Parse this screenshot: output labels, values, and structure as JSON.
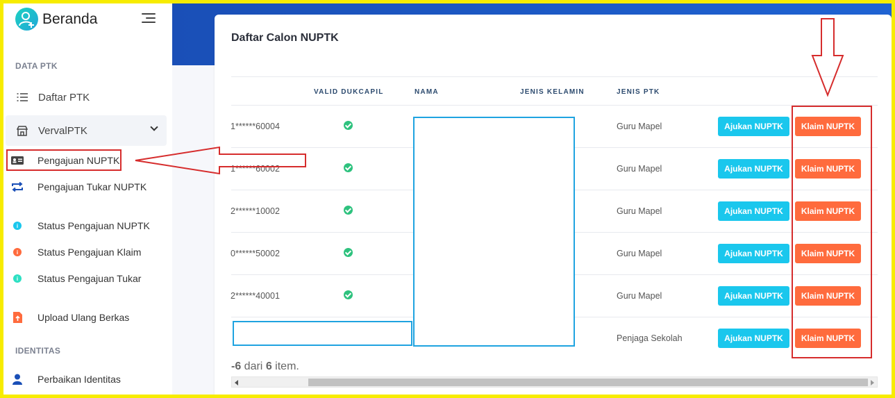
{
  "sidebar": {
    "brand": "Beranda",
    "section_data_ptk": "DATA PTK",
    "section_identitas": "IDENTITAS",
    "items": [
      {
        "label": "Daftar PTK",
        "icon": "list-icon"
      },
      {
        "label": "VervalPTK",
        "icon": "store-icon"
      },
      {
        "label": "Pengajuan NUPTK",
        "icon": "id-card-icon"
      },
      {
        "label": "Pengajuan Tukar NUPTK",
        "icon": "swap-icon"
      },
      {
        "label": "Status Pengajuan NUPTK",
        "icon": "info-icon",
        "color": "#1ac7ed"
      },
      {
        "label": "Status Pengajuan Klaim",
        "icon": "info-icon",
        "color": "#ff6b3d"
      },
      {
        "label": "Status Pengajuan Tukar",
        "icon": "info-icon",
        "color": "#2ee0c3"
      },
      {
        "label": "Upload Ulang Berkas",
        "icon": "file-upload-icon"
      },
      {
        "label": "Perbaikan Identitas",
        "icon": "user-icon"
      }
    ]
  },
  "main": {
    "title": "Daftar Calon NUPTK",
    "headers": [
      "VALID DUKCAPIL",
      "NAMA",
      "JENIS KELAMIN",
      "JENIS PTK"
    ],
    "rows": [
      {
        "id": "1******60004",
        "jenis_ptk": "Guru Mapel"
      },
      {
        "id": "1******60002",
        "jenis_ptk": "Guru Mapel"
      },
      {
        "id": "2******10002",
        "jenis_ptk": "Guru Mapel"
      },
      {
        "id": "0******50002",
        "jenis_ptk": "Guru Mapel"
      },
      {
        "id": "2******40001",
        "jenis_ptk": "Guru Mapel"
      },
      {
        "id": "",
        "jenis_ptk": "Penjaga Sekolah"
      }
    ],
    "btn_ajukan": "Ajukan NUPTK",
    "btn_klaim": "Klaim NUPTK",
    "footer": {
      "prefix": "-6",
      "mid": " dari ",
      "count": "6",
      "suffix": " item."
    }
  },
  "colors": {
    "accent": "#1a4fb7",
    "ajukan": "#1ac7ed",
    "klaim": "#ff6b3d",
    "annotation": "#d62c2c"
  }
}
